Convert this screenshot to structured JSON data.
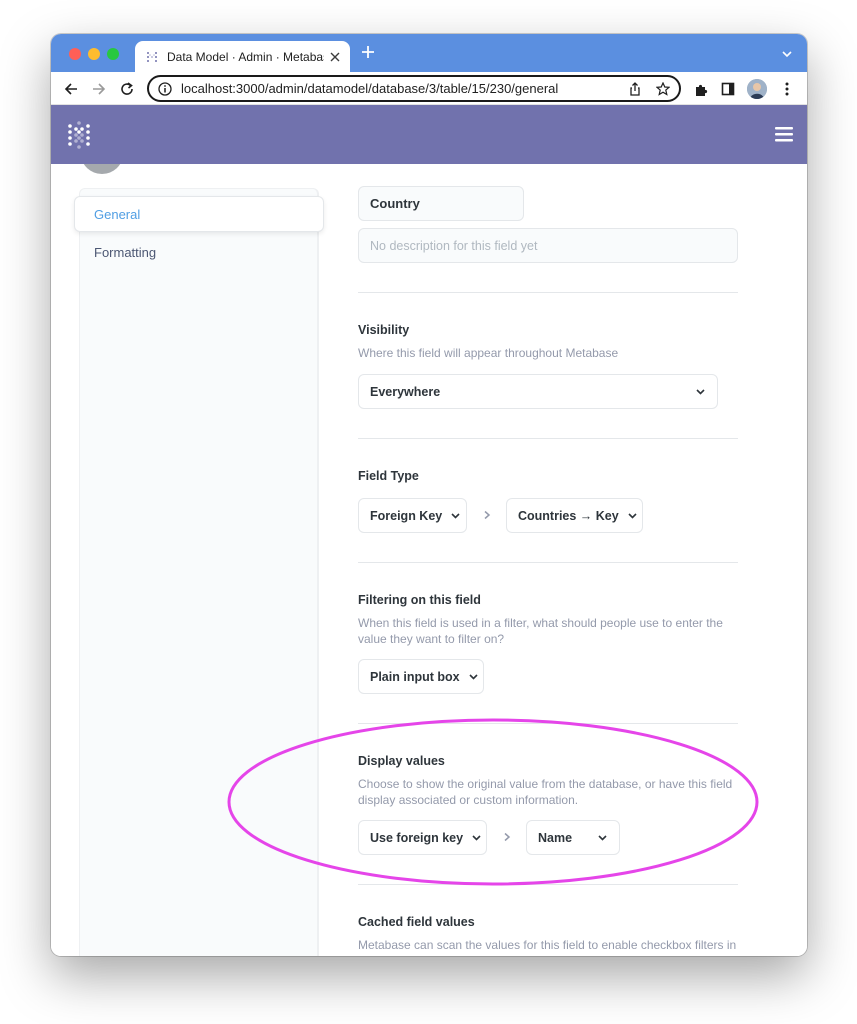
{
  "browser": {
    "tab_title": "Data Model · Admin · Metabase",
    "url": "localhost:3000/admin/datamodel/database/3/table/15/230/general"
  },
  "sidebar": {
    "items": [
      {
        "label": "General",
        "active": true
      },
      {
        "label": "Formatting",
        "active": false
      }
    ]
  },
  "field": {
    "name": "Country",
    "description_placeholder": "No description for this field yet"
  },
  "visibility": {
    "title": "Visibility",
    "description": "Where this field will appear throughout Metabase",
    "value": "Everywhere"
  },
  "field_type": {
    "title": "Field Type",
    "type_value": "Foreign Key",
    "target_value": "Countries → Key"
  },
  "filtering": {
    "title": "Filtering on this field",
    "description": "When this field is used in a filter, what should people use to enter the value they want to filter on?",
    "value": "Plain input box"
  },
  "display_values": {
    "title": "Display values",
    "description": "Choose to show the original value from the database, or have this field display associated or custom information.",
    "mode_value": "Use foreign key",
    "column_value": "Name"
  },
  "cached_values": {
    "title": "Cached field values",
    "description": "Metabase can scan the values for this field to enable checkbox filters in dashboards and questions."
  },
  "colors": {
    "tab_strip": "#5b8fe0",
    "metabase_nav": "#7172ad",
    "brand_blue": "#509ee3",
    "highlight": "#e545e9"
  },
  "icons": {
    "tab_favicon": "metabase-logo-icon",
    "tab_close": "close-icon",
    "new_tab": "plus-icon",
    "tab_menu": "chevron-down-icon",
    "back": "arrow-left-icon",
    "forward": "arrow-right-icon",
    "reload": "reload-icon",
    "site_info": "info-icon",
    "share": "share-icon",
    "bookmark": "star-icon",
    "extensions": "puzzle-icon",
    "side_panel": "side-panel-icon",
    "profile": "avatar",
    "more": "kebab-icon",
    "logo": "metabase-logo-icon",
    "menu": "hamburger-icon"
  }
}
